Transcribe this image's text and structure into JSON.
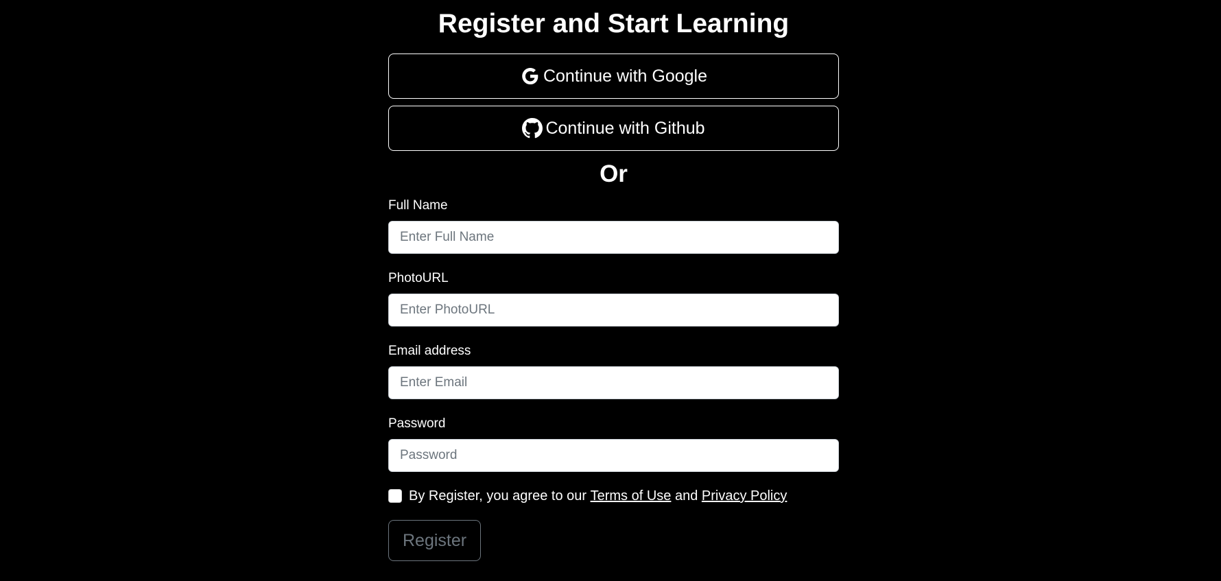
{
  "title": "Register and Start Learning",
  "oauth": {
    "google_label": "Continue with Google",
    "github_label": "Continue with Github"
  },
  "divider_text": "Or",
  "form": {
    "full_name": {
      "label": "Full Name",
      "placeholder": "Enter Full Name",
      "value": ""
    },
    "photo_url": {
      "label": "PhotoURL",
      "placeholder": "Enter PhotoURL",
      "value": ""
    },
    "email": {
      "label": "Email address",
      "placeholder": "Enter Email",
      "value": ""
    },
    "password": {
      "label": "Password",
      "placeholder": "Password",
      "value": ""
    }
  },
  "agreement": {
    "checked": false,
    "prefix": "By Register, you agree to our ",
    "terms_link": "Terms of Use",
    "middle": " and ",
    "privacy_link": "Privacy Policy"
  },
  "register_label": "Register",
  "colors": {
    "background": "#000000",
    "text": "#ffffff",
    "button_border": "#ffffff",
    "disabled_button": "#6c757d",
    "input_background": "#ffffff",
    "placeholder": "#6c757d"
  },
  "icons": {
    "google": "google-icon",
    "github": "github-icon"
  }
}
